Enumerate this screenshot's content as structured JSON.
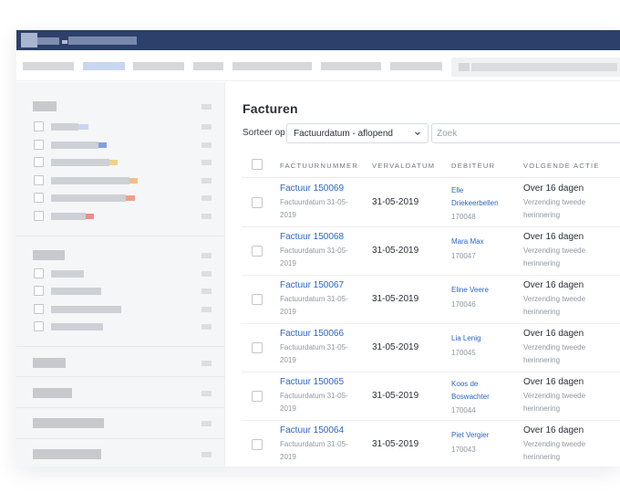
{
  "colors": {
    "topbar": "#2d3f6b",
    "link": "#2a66c9",
    "sidebar_bg": "#f5f6f8"
  },
  "main": {
    "title": "Facturen",
    "sort_label": "Sorteer op",
    "sort_value": "Factuurdatum - aflopend",
    "search_placeholder": "Zoek",
    "headers": {
      "invoice_number": "FACTUURNUMMER",
      "due_date": "VERVALDATUM",
      "debtor": "DEBITEUR",
      "next_action": "VOLGENDE ACTIE"
    },
    "rows": [
      {
        "invoice": "Factuur 150069",
        "invoice_date": "Factuurdatum 31-05-2019",
        "due": "31-05-2019",
        "debtor": "Elle Driekeerbellen",
        "debtor_id": "170048",
        "action": "Over 16 dagen",
        "action_detail": "Verzending tweede herinnering"
      },
      {
        "invoice": "Factuur 150068",
        "invoice_date": "Factuurdatum 31-05-2019",
        "due": "31-05-2019",
        "debtor": "Mara Max",
        "debtor_id": "170047",
        "action": "Over 16 dagen",
        "action_detail": "Verzending tweede herinnering"
      },
      {
        "invoice": "Factuur 150067",
        "invoice_date": "Factuurdatum 31-05-2019",
        "due": "31-05-2019",
        "debtor": "Eline Veere",
        "debtor_id": "170046",
        "action": "Over 16 dagen",
        "action_detail": "Verzending tweede herinnering"
      },
      {
        "invoice": "Factuur 150066",
        "invoice_date": "Factuurdatum 31-05-2019",
        "due": "31-05-2019",
        "debtor": "Lia Lenig",
        "debtor_id": "170045",
        "action": "Over 16 dagen",
        "action_detail": "Verzending tweede herinnering"
      },
      {
        "invoice": "Factuur 150065",
        "invoice_date": "Factuurdatum 31-05-2019",
        "due": "31-05-2019",
        "debtor": "Koos de Boswachter",
        "debtor_id": "170044",
        "action": "Over 16 dagen",
        "action_detail": "Verzending tweede herinnering"
      },
      {
        "invoice": "Factuur 150064",
        "invoice_date": "Factuurdatum 31-05-2019",
        "due": "31-05-2019",
        "debtor": "Piet Vergier",
        "debtor_id": "170043",
        "action": "Over 16 dagen",
        "action_detail": "Verzending tweede herinnering"
      }
    ]
  }
}
